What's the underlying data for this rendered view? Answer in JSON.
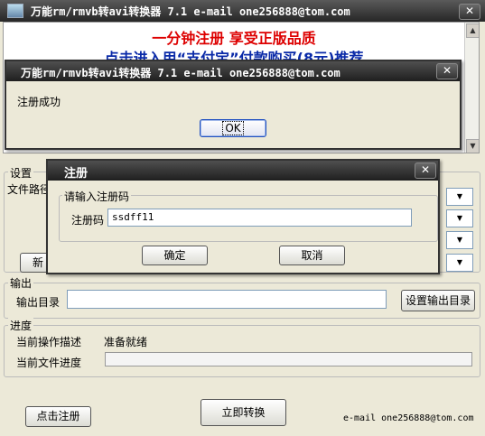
{
  "main_window": {
    "title": "万能rm/rmvb转avi转换器 7.1   e-mail one256888@tom.com",
    "close_label": "✕"
  },
  "ad": {
    "line1": "一分钟注册 享受正版品质",
    "line2": "点击进入用“支付宝”付款购买(8元)推荐"
  },
  "settings": {
    "group_label": "设置",
    "file_path_label": "文件路径",
    "new_button_label": "新"
  },
  "output": {
    "group_label": "输出",
    "dir_label": "输出目录",
    "dir_value": "",
    "set_dir_button": "设置输出目录"
  },
  "progress": {
    "group_label": "进度",
    "op_desc_label": "当前操作描述",
    "op_desc_value": "准备就绪",
    "file_progress_label": "当前文件进度",
    "value": 0
  },
  "footer": {
    "register_button": "点击注册",
    "convert_button": "立即转换",
    "email": "e-mail one256888@tom.com"
  },
  "success_dialog": {
    "title": "万能rm/rmvb转avi转换器 7.1   e-mail one256888@tom.com",
    "message": "注册成功",
    "ok_button": "OK",
    "close_label": "✕"
  },
  "register_dialog": {
    "title": "注册",
    "group_label": "请输入注册码",
    "code_label": "注册码",
    "code_value": "ssdff11",
    "ok_button": "确定",
    "cancel_button": "取消",
    "close_label": "✕"
  },
  "colors": {
    "ad_red": "#dd0000",
    "ad_blue": "#0a2aa8",
    "titlebar": "#2a2a2a"
  }
}
